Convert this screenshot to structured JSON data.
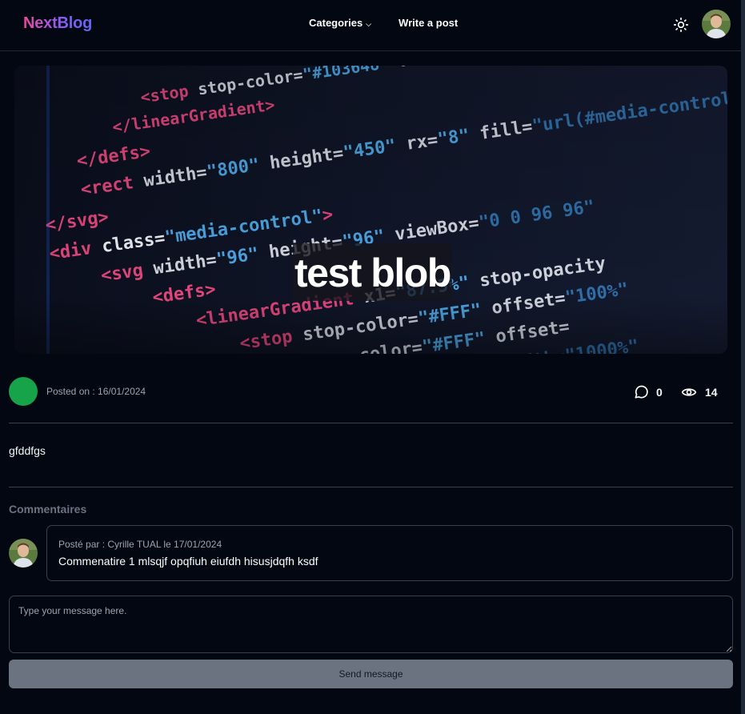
{
  "header": {
    "logo": "NextBlog",
    "nav": {
      "categories": "Categories",
      "write_post": "Write a post"
    },
    "icons": {
      "theme_toggle": "sun-icon",
      "dropdown": "chevron-down-icon"
    }
  },
  "post": {
    "title": "test blob",
    "posted_on": "Posted on : 16/01/2024",
    "comments_count": "0",
    "views_count": "14",
    "body": "gfddfgs"
  },
  "comments": {
    "heading": "Commentaires",
    "items": [
      {
        "meta": "Posté par : Cyrille TUAL le 17/01/2024",
        "text": "Commenatire 1 mlsqjf opqfiuh eiufdh hisusjdqfh ksdf"
      }
    ]
  },
  "composer": {
    "placeholder": "Type your message here.",
    "send_label": "Send message"
  },
  "colors": {
    "background": "#030712",
    "logo_gradient": [
      "#ec4899",
      "#8b5cf6",
      "#6366f1"
    ],
    "author_avatar": "#16a34a",
    "send_button": "#6b7280"
  }
}
